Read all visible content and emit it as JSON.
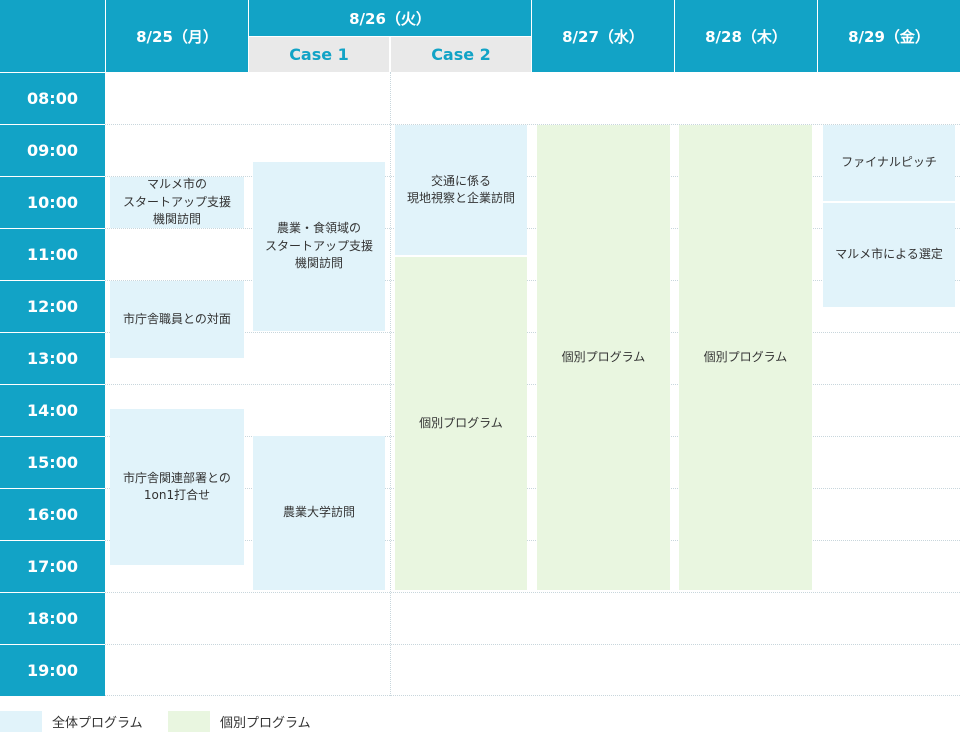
{
  "header": {
    "days": [
      {
        "label": "8/25（月）"
      },
      {
        "label": "8/26（火）",
        "cases": [
          "Case 1",
          "Case 2"
        ]
      },
      {
        "label": "8/27（水）"
      },
      {
        "label": "8/28（木）"
      },
      {
        "label": "8/29（金）"
      }
    ]
  },
  "times": [
    "08:00",
    "09:00",
    "10:00",
    "11:00",
    "12:00",
    "13:00",
    "14:00",
    "15:00",
    "16:00",
    "17:00",
    "18:00",
    "19:00"
  ],
  "events": {
    "mon_1": "マルメ市の\nスタートアップ支援\n機関訪問",
    "mon_2": "市庁舎職員との対面",
    "mon_3": "市庁舎関連部署との\n1on1打合せ",
    "tue_c1_1": "農業・食領域の\nスタートアップ支援\n機関訪問",
    "tue_c1_2": "農業大学訪問",
    "tue_c2_1": "交通に係る\n現地視察と企業訪問",
    "tue_c2_2": "個別プログラム",
    "wed_1": "個別プログラム",
    "thu_1": "個別プログラム",
    "fri_1": "ファイナルピッチ",
    "fri_2": "マルメ市による選定"
  },
  "legend": {
    "all": {
      "label": "全体プログラム",
      "color": "#e1f3fa"
    },
    "individual": {
      "label": "個別プログラム",
      "color": "#e9f6e0"
    }
  },
  "colors": {
    "header": "#12a3c6",
    "subheader": "#e9e9e9"
  }
}
